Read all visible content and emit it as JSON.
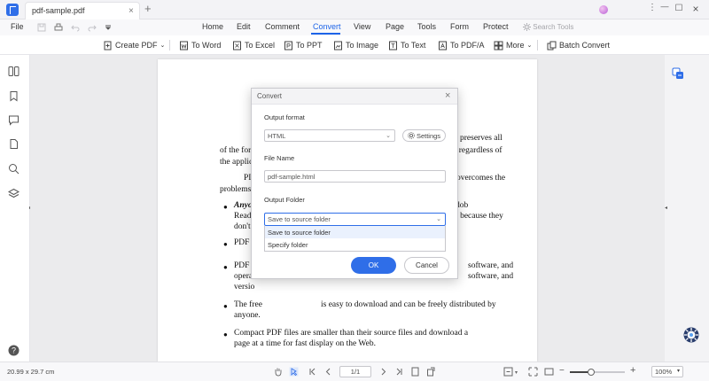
{
  "titlebar": {
    "tab_label": "pdf-sample.pdf",
    "close_glyph": "×",
    "new_tab_glyph": "+",
    "avatar_icon": "user-avatar",
    "minimize_glyph": "—",
    "maximize_glyph": "☐",
    "close_window_glyph": "×"
  },
  "menubar": {
    "file_label": "File",
    "tabs": [
      "Home",
      "Edit",
      "Comment",
      "Convert",
      "View",
      "Page",
      "Tools",
      "Form",
      "Protect"
    ],
    "active_tab": "Convert",
    "search_placeholder": "Search Tools",
    "accent_color": "#1d64e8"
  },
  "toolbar": {
    "create_pdf": "Create PDF",
    "to_word": "To Word",
    "to_excel": "To Excel",
    "to_ppt": "To PPT",
    "to_image": "To Image",
    "to_text": "To Text",
    "to_pdfa": "To PDF/A",
    "more": "More",
    "batch_convert": "Batch Convert"
  },
  "document": {
    "lines": [
      {
        "id": "l1",
        "text": "t preserves all"
      },
      {
        "id": "l2",
        "text": "of the for"
      },
      {
        "id": "l2r",
        "text": ", regardless of"
      },
      {
        "id": "l3",
        "text": "the applic"
      },
      {
        "id": "l4",
        "text": "PI"
      },
      {
        "id": "l4r",
        "text": "overcomes the"
      },
      {
        "id": "l5",
        "text": "problems"
      },
      {
        "id": "l6",
        "text": "Anyo"
      },
      {
        "id": "l6r",
        "text": "dob"
      },
      {
        "id": "l7",
        "text": "Reade"
      },
      {
        "id": "l7r",
        "text": "s because they"
      },
      {
        "id": "l8",
        "text": "don't h"
      },
      {
        "id": "l9",
        "text": "PDF f"
      },
      {
        "id": "l10",
        "text": "PDF"
      },
      {
        "id": "l10r",
        "text": "software, and"
      },
      {
        "id": "l11",
        "text": "operat"
      },
      {
        "id": "l11r",
        "text": "software, and"
      },
      {
        "id": "l12",
        "text": "versio"
      },
      {
        "id": "l13",
        "text": "The free"
      },
      {
        "id": "l13r",
        "text": "is easy to download and can be freely distributed by"
      },
      {
        "id": "l14",
        "text": "anyone."
      },
      {
        "id": "l15",
        "text": "Compact PDF files are smaller than their source files and download a"
      },
      {
        "id": "l16",
        "text": "page at a time for fast display on the Web."
      }
    ]
  },
  "dialog": {
    "title": "Convert",
    "close_glyph": "×",
    "output_format_label": "Output format",
    "output_format_value": "HTML",
    "settings_label": "Settings",
    "file_name_label": "File Name",
    "file_name_value": "pdf-sample.html",
    "output_folder_label": "Output Folder",
    "output_folder_value": "Save to source folder",
    "folder_options": [
      "Save to source folder",
      "Specify folder"
    ],
    "ok_label": "OK",
    "cancel_label": "Cancel"
  },
  "statusbar": {
    "page_size": "20.99 x 29.7 cm",
    "page_indicator": "1/1",
    "zoom": "100%",
    "zoom_level": 0.38
  }
}
